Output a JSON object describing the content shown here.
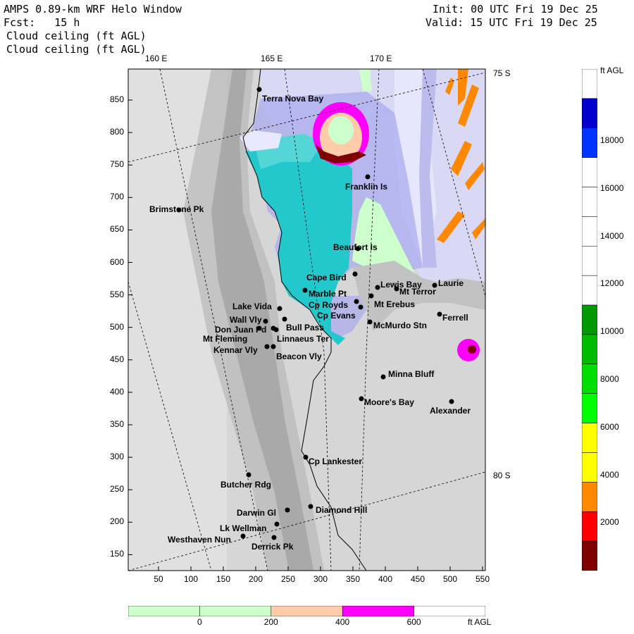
{
  "header": {
    "title": "AMPS 0.89-km WRF Helo Window",
    "forecast": "Fcst:   15 h",
    "init": "Init: 00 UTC Fri 19 Dec 25",
    "valid": "Valid: 15 UTC Fri 19 Dec 25",
    "field1": "Cloud ceiling (ft AGL)",
    "field2": "Cloud ceiling (ft AGL)"
  },
  "map": {
    "longitude_labels": [
      "160 E",
      "165 E",
      "170 E"
    ],
    "latitude_labels": [
      "75 S",
      "80 S"
    ],
    "y_ticks": [
      "850",
      "800",
      "750",
      "700",
      "650",
      "600",
      "550",
      "500",
      "450",
      "400",
      "350",
      "300",
      "250",
      "200",
      "150"
    ],
    "x_ticks": [
      "50",
      "100",
      "150",
      "200",
      "250",
      "300",
      "350",
      "400",
      "450",
      "500",
      "550"
    ],
    "stations": [
      {
        "name": "Terra Nova Bay"
      },
      {
        "name": "Franklin Is"
      },
      {
        "name": "Brimstone Pk"
      },
      {
        "name": "Beaufort Is"
      },
      {
        "name": "Cape Bird"
      },
      {
        "name": "Lewis Bay"
      },
      {
        "name": "Laurie"
      },
      {
        "name": "Marble Pt"
      },
      {
        "name": "Mt Terror"
      },
      {
        "name": "Cp Royds"
      },
      {
        "name": "Mt Erebus"
      },
      {
        "name": "Lake Vida"
      },
      {
        "name": "Cp Evans"
      },
      {
        "name": "Ferrell"
      },
      {
        "name": "Wall Vly"
      },
      {
        "name": "Bull Pass"
      },
      {
        "name": "McMurdo Stn"
      },
      {
        "name": "Don Juan Pd"
      },
      {
        "name": "Mt Fleming"
      },
      {
        "name": "Linnaeus Ter"
      },
      {
        "name": "Kennar Vly"
      },
      {
        "name": "Beacon Vly"
      },
      {
        "name": "Minna Bluff"
      },
      {
        "name": "Moore's Bay"
      },
      {
        "name": "Alexander"
      },
      {
        "name": "Cp Lankester"
      },
      {
        "name": "Butcher Rdg"
      },
      {
        "name": "Darwin Gl"
      },
      {
        "name": "Diamond Hill"
      },
      {
        "name": "Lk Wellman"
      },
      {
        "name": "Westhaven Nun"
      },
      {
        "name": "Derrick Pk"
      }
    ]
  },
  "colorbar_right": {
    "unit": "ft AGL",
    "labels": [
      "18000",
      "16000",
      "14000",
      "12000",
      "10000",
      "8000",
      "6000",
      "4000",
      "2000"
    ],
    "colors": [
      "#ffffff",
      "#0000cc",
      "#0033ff",
      "#ffffff",
      "#ffffff",
      "#ffffff",
      "#ffffff",
      "#ffffff",
      "#009900",
      "#00bb00",
      "#00dd00",
      "#00ff00",
      "#ffff00",
      "#ffff00",
      "#ff8800",
      "#ff0000",
      "#800000"
    ]
  },
  "colorbar_bottom": {
    "unit": "ft AGL",
    "labels": [
      "0",
      "200",
      "400",
      "600"
    ],
    "colors": [
      "#ccffcc",
      "#ccffcc",
      "#ffccaa",
      "#ff00ff",
      "#ffffff"
    ]
  }
}
